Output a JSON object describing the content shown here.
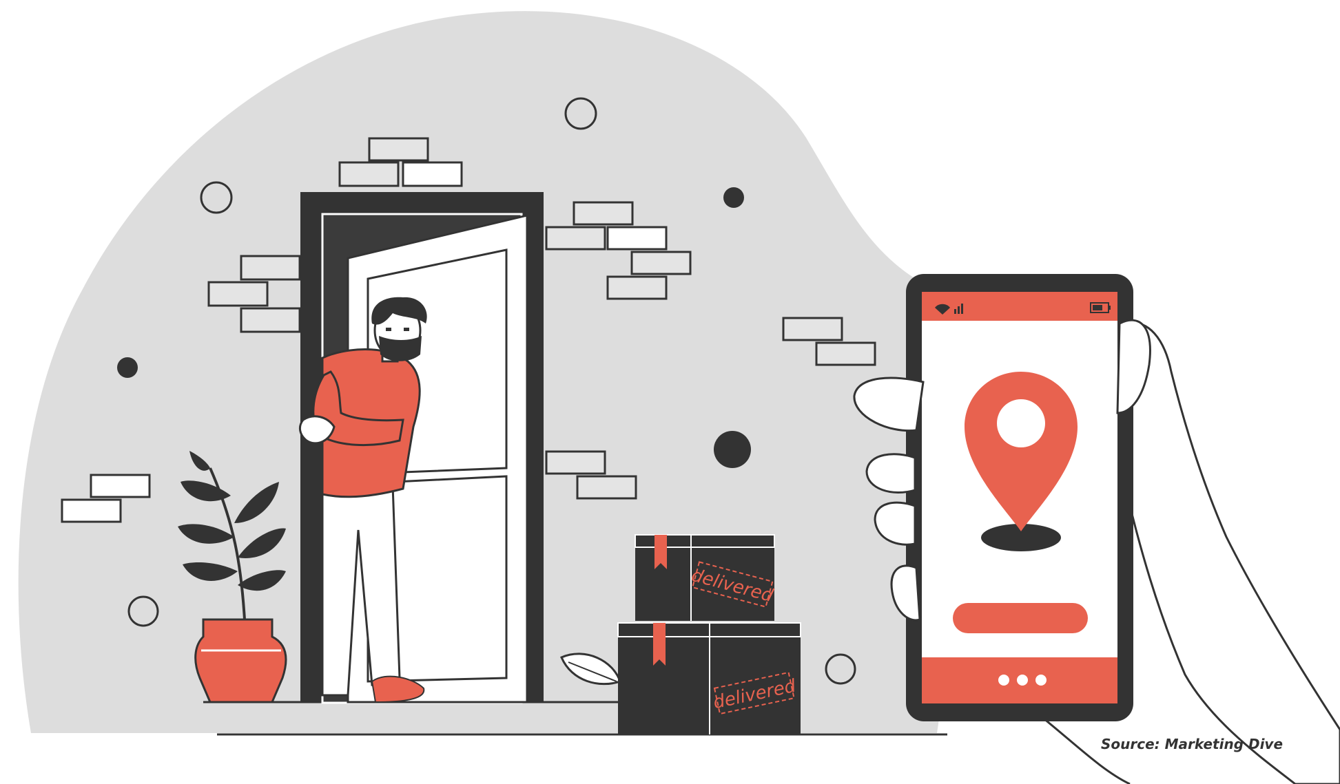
{
  "illustration": {
    "stamp_top": "delivered",
    "stamp_bottom": "delivered",
    "phone_status_icons": [
      "wifi-icon",
      "signal-icon",
      "battery-icon"
    ],
    "phone_map_icon": "location-pin-icon"
  },
  "caption": {
    "source": "Source: Marketing Dive"
  },
  "colors": {
    "accent": "#e8624f",
    "dark": "#333333",
    "background_blob": "#dddddd",
    "white": "#ffffff"
  }
}
